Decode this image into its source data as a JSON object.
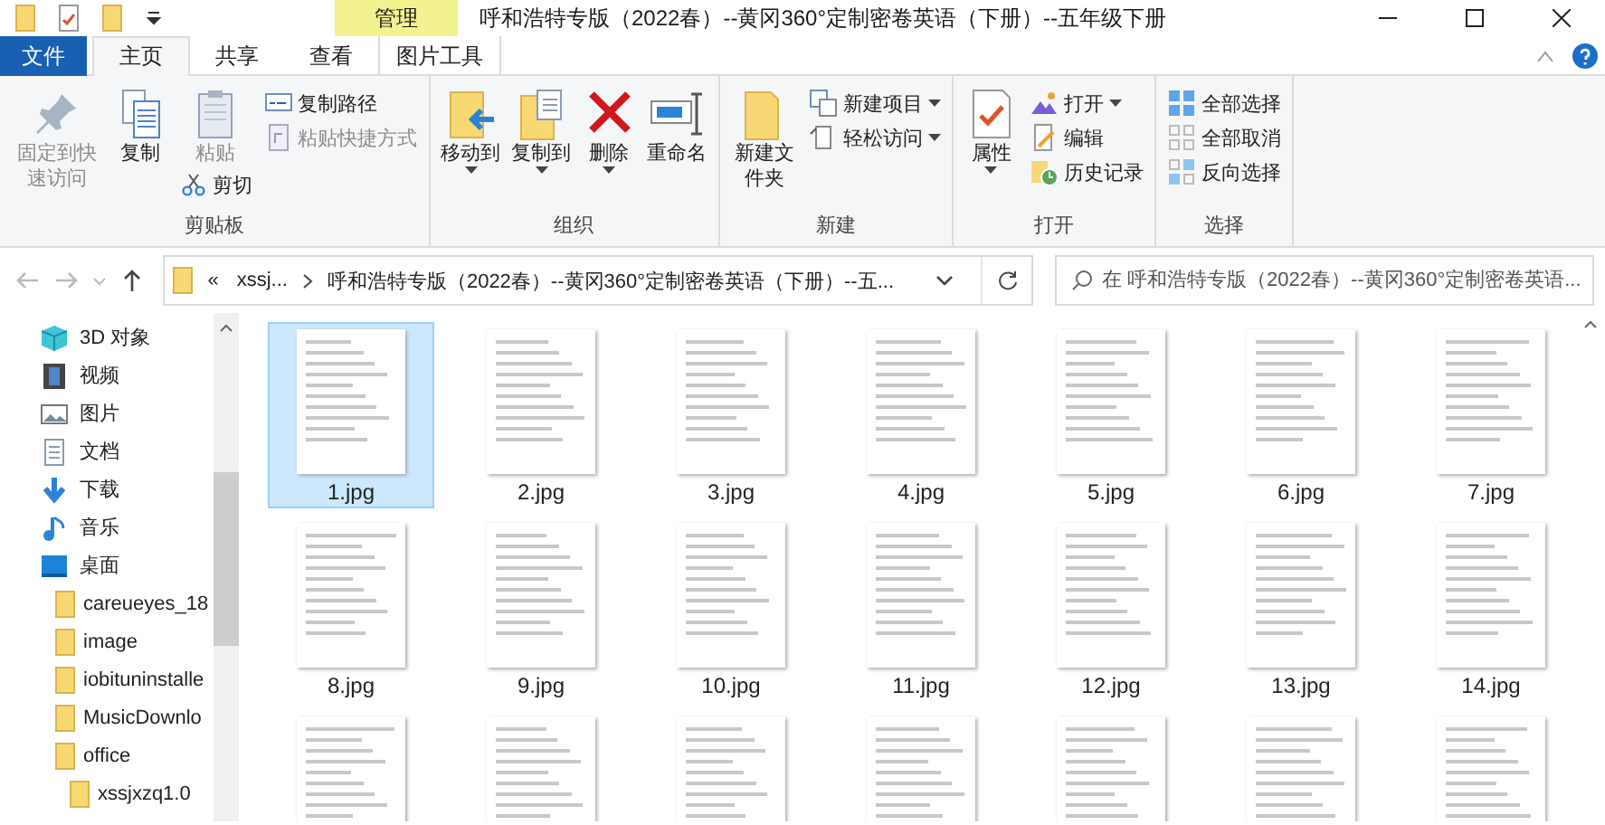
{
  "window": {
    "title": "呼和浩特专版（2022春）--黄冈360°定制密卷英语（下册）--五年级下册"
  },
  "contextual_header": "管理",
  "ribbon_tabs": [
    {
      "label": "文件",
      "kind": "file",
      "selected": false
    },
    {
      "label": "主页",
      "kind": "plain",
      "selected": true
    },
    {
      "label": "共享",
      "kind": "plain",
      "selected": false
    },
    {
      "label": "查看",
      "kind": "plain",
      "selected": false
    },
    {
      "label": "图片工具",
      "kind": "context",
      "selected": false
    }
  ],
  "ribbon_groups": [
    {
      "label": "剪贴板",
      "items": [
        {
          "kind": "large",
          "label": "固定到快速访问",
          "disabled": true,
          "dropdown": false
        },
        {
          "kind": "large",
          "label": "复制",
          "disabled": false,
          "dropdown": false
        },
        {
          "kind": "large",
          "label": "粘贴",
          "disabled": true,
          "dropdown": false,
          "below": {
            "label": "剪切",
            "disabled": false
          }
        },
        {
          "kind": "stack",
          "items": [
            {
              "label": "复制路径",
              "disabled": false,
              "dropdown": false
            },
            {
              "label": "粘贴快捷方式",
              "disabled": true,
              "dropdown": false
            }
          ]
        }
      ]
    },
    {
      "label": "组织",
      "items": [
        {
          "kind": "large",
          "label": "移动到",
          "disabled": false,
          "dropdown": true
        },
        {
          "kind": "large",
          "label": "复制到",
          "disabled": false,
          "dropdown": true
        },
        {
          "kind": "large",
          "label": "删除",
          "disabled": false,
          "dropdown": true
        },
        {
          "kind": "large",
          "label": "重命名",
          "disabled": false,
          "dropdown": false
        }
      ]
    },
    {
      "label": "新建",
      "items": [
        {
          "kind": "large",
          "label": "新建文件夹",
          "disabled": false,
          "dropdown": false
        },
        {
          "kind": "stack",
          "items": [
            {
              "label": "新建项目",
              "disabled": false,
              "dropdown": true
            },
            {
              "label": "轻松访问",
              "disabled": false,
              "dropdown": true
            }
          ]
        }
      ]
    },
    {
      "label": "打开",
      "items": [
        {
          "kind": "large",
          "label": "属性",
          "disabled": false,
          "dropdown": true
        },
        {
          "kind": "stack",
          "items": [
            {
              "label": "打开",
              "disabled": false,
              "dropdown": true
            },
            {
              "label": "编辑",
              "disabled": false,
              "dropdown": false
            },
            {
              "label": "历史记录",
              "disabled": false,
              "dropdown": false
            }
          ]
        }
      ]
    },
    {
      "label": "选择",
      "items": [
        {
          "kind": "stack",
          "items": [
            {
              "label": "全部选择",
              "disabled": false,
              "dropdown": false
            },
            {
              "label": "全部取消",
              "disabled": false,
              "dropdown": false
            },
            {
              "label": "反向选择",
              "disabled": false,
              "dropdown": false
            }
          ]
        }
      ]
    }
  ],
  "address_bar": {
    "overflow": "«",
    "breadcrumbs": [
      "xssj...",
      "呼和浩特专版（2022春）--黄冈360°定制密卷英语（下册）--五..."
    ]
  },
  "search": {
    "placeholder": "在 呼和浩特专版（2022春）--黄冈360°定制密卷英语..."
  },
  "sidebar": {
    "items": [
      {
        "label": "3D 对象",
        "kind": "objects3d"
      },
      {
        "label": "视频",
        "kind": "video"
      },
      {
        "label": "图片",
        "kind": "pictures"
      },
      {
        "label": "文档",
        "kind": "documents"
      },
      {
        "label": "下载",
        "kind": "downloads"
      },
      {
        "label": "音乐",
        "kind": "music"
      },
      {
        "label": "桌面",
        "kind": "desktop",
        "children": [
          {
            "label": "careueyes_18",
            "kind": "folder"
          },
          {
            "label": "image",
            "kind": "folder"
          },
          {
            "label": "iobituninstalle",
            "kind": "folder"
          },
          {
            "label": "MusicDownlo",
            "kind": "folder"
          },
          {
            "label": "office",
            "kind": "folder",
            "children": [
              {
                "label": "xssjxzq1.0",
                "kind": "folder"
              }
            ]
          }
        ]
      }
    ]
  },
  "files": [
    {
      "name": "1.jpg",
      "selected": true
    },
    {
      "name": "2.jpg",
      "selected": false
    },
    {
      "name": "3.jpg",
      "selected": false
    },
    {
      "name": "4.jpg",
      "selected": false
    },
    {
      "name": "5.jpg",
      "selected": false
    },
    {
      "name": "6.jpg",
      "selected": false
    },
    {
      "name": "7.jpg",
      "selected": false
    },
    {
      "name": "8.jpg",
      "selected": false
    },
    {
      "name": "9.jpg",
      "selected": false
    },
    {
      "name": "10.jpg",
      "selected": false
    },
    {
      "name": "11.jpg",
      "selected": false
    },
    {
      "name": "12.jpg",
      "selected": false
    },
    {
      "name": "13.jpg",
      "selected": false
    },
    {
      "name": "14.jpg",
      "selected": false
    },
    {
      "selected": false
    },
    {
      "selected": false
    },
    {
      "selected": false
    },
    {
      "selected": false
    },
    {
      "selected": false
    },
    {
      "selected": false
    },
    {
      "selected": false
    }
  ]
}
